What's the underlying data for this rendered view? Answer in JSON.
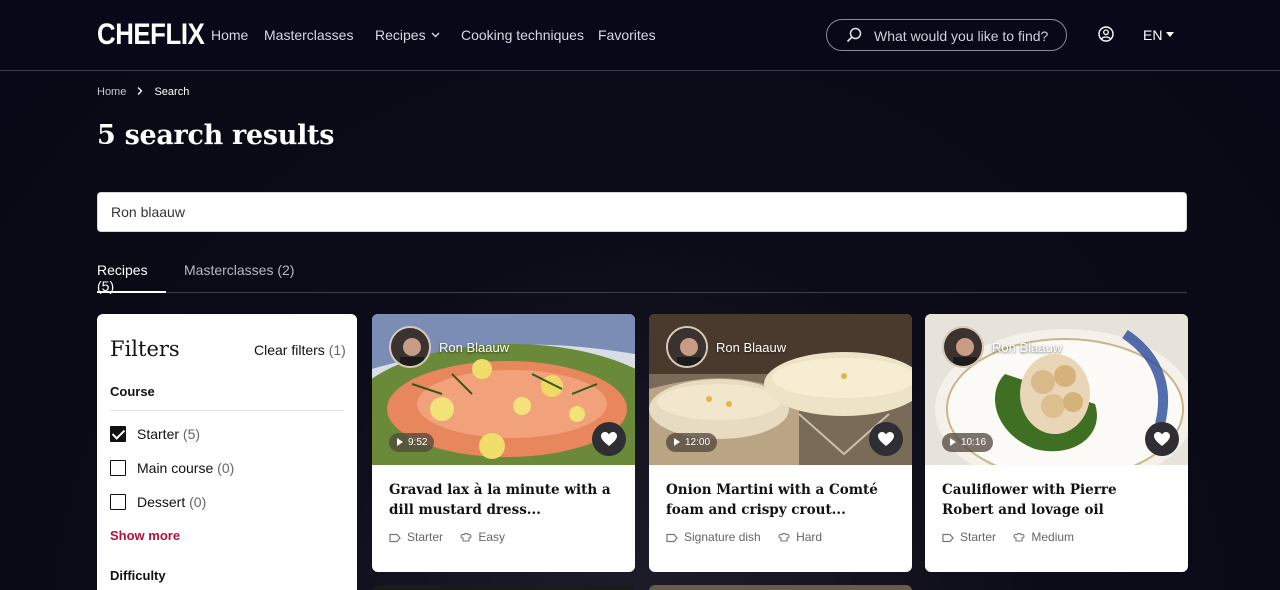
{
  "header": {
    "logo": "CHEFLIX",
    "nav": {
      "home": "Home",
      "masterclasses": "Masterclasses",
      "recipes": "Recipes",
      "techniques": "Cooking techniques",
      "favorites": "Favorites"
    },
    "search_placeholder": "What would you like to find?",
    "language": "EN"
  },
  "breadcrumb": {
    "home": "Home",
    "current": "Search"
  },
  "page_title": "5 search results",
  "search": {
    "value": "Ron blaauw"
  },
  "tabs": {
    "recipes": "Recipes (5)",
    "masterclasses": "Masterclasses (2)"
  },
  "filters": {
    "title": "Filters",
    "clear_label": "Clear filters",
    "clear_count": "(1)",
    "course_heading": "Course",
    "options": [
      {
        "label": "Starter",
        "count": "(5)",
        "checked": true
      },
      {
        "label": "Main course",
        "count": "(0)",
        "checked": false
      },
      {
        "label": "Dessert",
        "count": "(0)",
        "checked": false
      }
    ],
    "show_more": "Show more",
    "difficulty_heading": "Difficulty"
  },
  "cards": [
    {
      "chef": "Ron Blaauw",
      "duration": "9:52",
      "title": "Gravad lax à la minute with a dill mustard dress...",
      "category": "Starter",
      "difficulty": "Easy"
    },
    {
      "chef": "Ron Blaauw",
      "duration": "12:00",
      "title": "Onion Martini with a Comté foam and crispy crout...",
      "category": "Signature dish",
      "difficulty": "Hard"
    },
    {
      "chef": "Ron Blaauw",
      "duration": "10:16",
      "title": "Cauliflower with Pierre Robert and lovage oil",
      "category": "Starter",
      "difficulty": "Medium"
    }
  ],
  "colors": {
    "accent": "#b5123a",
    "background": "#080816"
  }
}
